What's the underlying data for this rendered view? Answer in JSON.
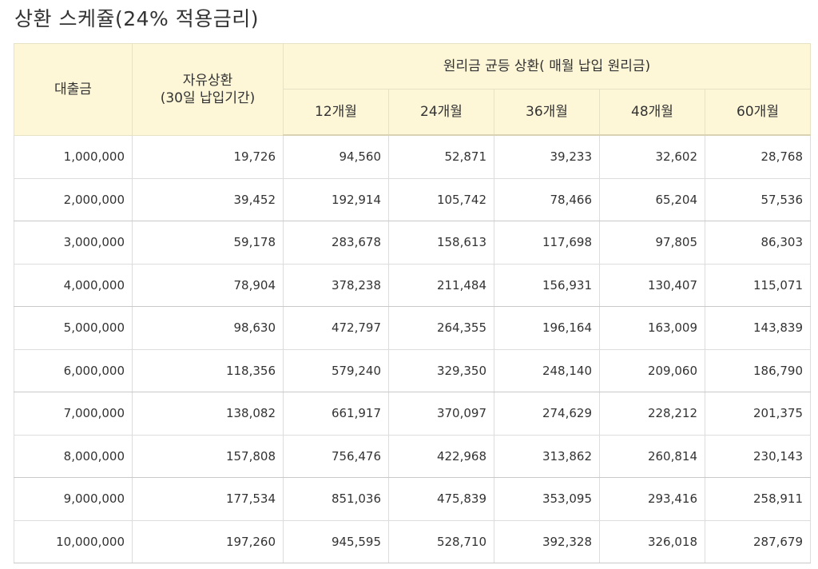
{
  "title": "상환 스케쥴(24% 적용금리)",
  "table": {
    "header": {
      "loan": "대출금",
      "free_line1": "자유상환",
      "free_line2": "(30일 납입기간)",
      "equal_group": "원리금 균등 상환( 매월 납입 원리금)",
      "terms": [
        "12개월",
        "24개월",
        "36개월",
        "48개월",
        "60개월"
      ]
    },
    "rows": [
      [
        "1,000,000",
        "19,726",
        "94,560",
        "52,871",
        "39,233",
        "32,602",
        "28,768"
      ],
      [
        "2,000,000",
        "39,452",
        "192,914",
        "105,742",
        "78,466",
        "65,204",
        "57,536"
      ],
      [
        "3,000,000",
        "59,178",
        "283,678",
        "158,613",
        "117,698",
        "97,805",
        "86,303"
      ],
      [
        "4,000,000",
        "78,904",
        "378,238",
        "211,484",
        "156,931",
        "130,407",
        "115,071"
      ],
      [
        "5,000,000",
        "98,630",
        "472,797",
        "264,355",
        "196,164",
        "163,009",
        "143,839"
      ],
      [
        "6,000,000",
        "118,356",
        "579,240",
        "329,350",
        "248,140",
        "209,060",
        "186,790"
      ],
      [
        "7,000,000",
        "138,082",
        "661,917",
        "370,097",
        "274,629",
        "228,212",
        "201,375"
      ],
      [
        "8,000,000",
        "157,808",
        "756,476",
        "422,968",
        "313,862",
        "260,814",
        "230,143"
      ],
      [
        "9,000,000",
        "177,534",
        "851,036",
        "475,839",
        "353,095",
        "293,416",
        "258,911"
      ],
      [
        "10,000,000",
        "197,260",
        "945,595",
        "528,710",
        "392,328",
        "326,018",
        "287,679"
      ]
    ]
  }
}
